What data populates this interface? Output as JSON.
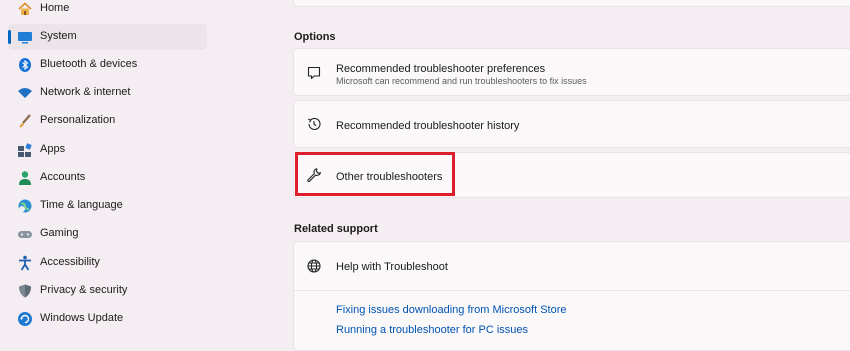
{
  "sidebar": {
    "items": [
      {
        "label": "Home",
        "icon": "home-icon"
      },
      {
        "label": "System",
        "icon": "system-icon"
      },
      {
        "label": "Bluetooth & devices",
        "icon": "bluetooth-icon"
      },
      {
        "label": "Network & internet",
        "icon": "wifi-icon"
      },
      {
        "label": "Personalization",
        "icon": "brush-icon"
      },
      {
        "label": "Apps",
        "icon": "apps-icon"
      },
      {
        "label": "Accounts",
        "icon": "person-icon"
      },
      {
        "label": "Time & language",
        "icon": "globe-clock-icon"
      },
      {
        "label": "Gaming",
        "icon": "controller-icon"
      },
      {
        "label": "Accessibility",
        "icon": "accessibility-icon"
      },
      {
        "label": "Privacy & security",
        "icon": "shield-icon"
      },
      {
        "label": "Windows Update",
        "icon": "update-icon"
      }
    ],
    "selected": "System"
  },
  "options": {
    "title": "Options",
    "rows": [
      {
        "title": "Recommended troubleshooter preferences",
        "subtitle": "Microsoft can recommend and run troubleshooters to fix issues",
        "icon": "chat-bubble-icon"
      },
      {
        "title": "Recommended troubleshooter history",
        "icon": "history-icon"
      },
      {
        "title": "Other troubleshooters",
        "icon": "wrench-icon"
      }
    ]
  },
  "related": {
    "title": "Related support",
    "card_title": "Help with Troubleshoot",
    "card_icon": "globe-icon",
    "links": [
      "Fixing issues downloading from Microsoft Store",
      "Running a troubleshooter for PC issues"
    ]
  },
  "colors": {
    "accent": "#0067c0",
    "highlight": "#dd1f2d",
    "link": "#0054b3"
  }
}
